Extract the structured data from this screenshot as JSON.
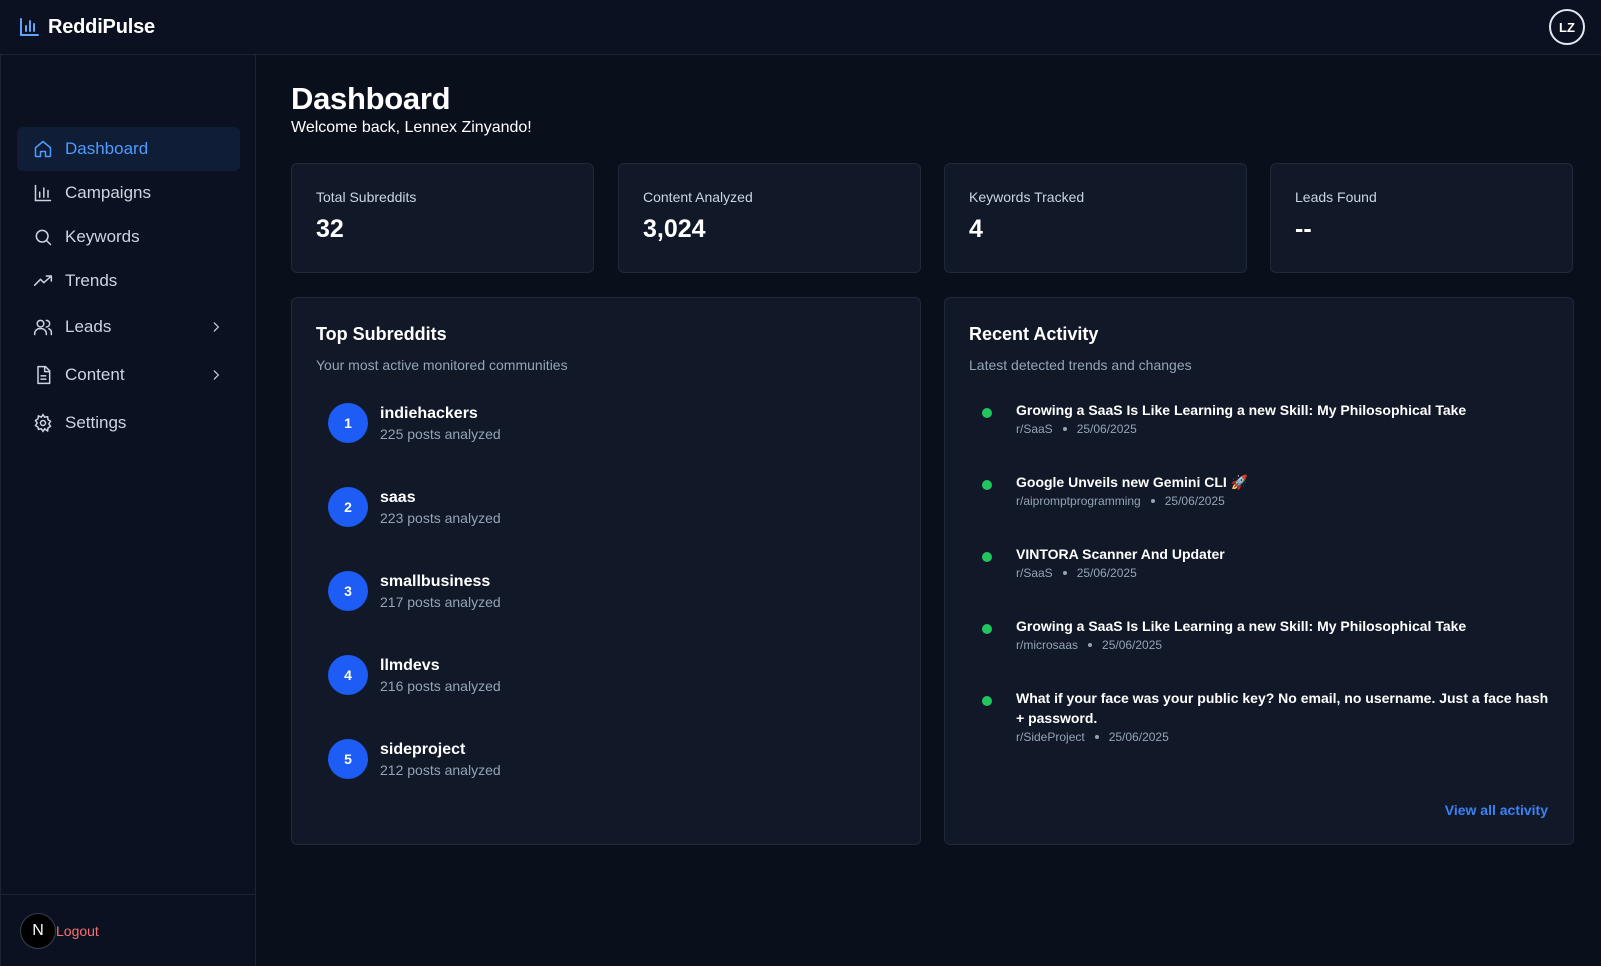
{
  "app": {
    "name": "ReddiPulse",
    "user_initials": "LZ"
  },
  "sidebar": {
    "items": [
      {
        "label": "Dashboard",
        "icon": "home-icon",
        "active": true
      },
      {
        "label": "Campaigns",
        "icon": "bar-chart-icon"
      },
      {
        "label": "Keywords",
        "icon": "search-icon"
      },
      {
        "label": "Trends",
        "icon": "trending-up-icon"
      },
      {
        "label": "Leads",
        "icon": "users-icon",
        "expandable": true
      },
      {
        "label": "Content",
        "icon": "document-icon",
        "expandable": true
      },
      {
        "label": "Settings",
        "icon": "gear-icon"
      }
    ],
    "bottom_badge": "N",
    "logout_label": "Logout"
  },
  "header": {
    "title": "Dashboard",
    "welcome": "Welcome back, Lennex Zinyando!"
  },
  "stats": [
    {
      "label": "Total Subreddits",
      "value": "32"
    },
    {
      "label": "Content Analyzed",
      "value": "3,024"
    },
    {
      "label": "Keywords Tracked",
      "value": "4"
    },
    {
      "label": "Leads Found",
      "value": "--"
    }
  ],
  "top_subreddits": {
    "title": "Top Subreddits",
    "subtitle": "Your most active monitored communities",
    "items": [
      {
        "rank": "1",
        "name": "indiehackers",
        "count": "225 posts analyzed"
      },
      {
        "rank": "2",
        "name": "saas",
        "count": "223 posts analyzed"
      },
      {
        "rank": "3",
        "name": "smallbusiness",
        "count": "217 posts analyzed"
      },
      {
        "rank": "4",
        "name": "llmdevs",
        "count": "216 posts analyzed"
      },
      {
        "rank": "5",
        "name": "sideproject",
        "count": "212 posts analyzed"
      }
    ]
  },
  "recent_activity": {
    "title": "Recent Activity",
    "subtitle": "Latest detected trends and changes",
    "items": [
      {
        "title": "Growing a SaaS Is Like Learning a new Skill: My Philosophical Take",
        "subreddit": "r/SaaS",
        "date": "25/06/2025"
      },
      {
        "title": "Google Unveils new Gemini CLI 🚀",
        "subreddit": "r/aipromptprogramming",
        "date": "25/06/2025"
      },
      {
        "title": "VINTORA Scanner And Updater",
        "subreddit": "r/SaaS",
        "date": "25/06/2025"
      },
      {
        "title": "Growing a SaaS Is Like Learning a new Skill: My Philosophical Take",
        "subreddit": "r/microsaas",
        "date": "25/06/2025"
      },
      {
        "title": "What if your face was your public key? No email, no username. Just a face hash + password.",
        "subreddit": "r/SideProject",
        "date": "25/06/2025"
      }
    ],
    "view_all_label": "View all activity"
  },
  "colors": {
    "background": "#0a0f1c",
    "card": "#111827",
    "accent": "#3b82f6",
    "rank_badge": "#1d5cf5",
    "active_nav": "#4f9bff",
    "activity_dot": "#22c55e",
    "logout": "#f87171"
  }
}
